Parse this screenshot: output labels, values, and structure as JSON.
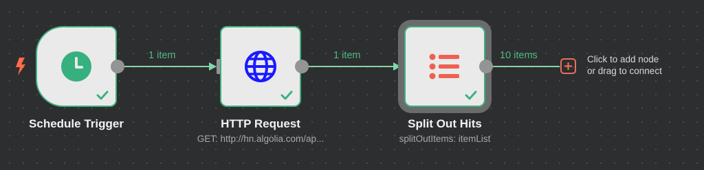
{
  "nodes": {
    "schedule_trigger": {
      "title": "Schedule Trigger",
      "subtitle": ""
    },
    "http_request": {
      "title": "HTTP Request",
      "subtitle": "GET: http://hn.algolia.com/ap..."
    },
    "split_out_hits": {
      "title": "Split Out Hits",
      "subtitle": "splitOutItems: itemList"
    }
  },
  "edges": [
    {
      "label": "1 item"
    },
    {
      "label": "1 item"
    },
    {
      "label": "10 items"
    }
  ],
  "add_node": {
    "hint_line1": "Click to add node",
    "hint_line2": "or drag to connect"
  },
  "colors": {
    "success": "#3fb07c",
    "edge": "#7fd8a8",
    "edge_label": "#4fb985",
    "trigger_icon": "#36b07f",
    "http_icon": "#1a1aff",
    "split_icon": "#ef6050",
    "add_button": "#e8705d",
    "bolt": "#ff6b4a"
  },
  "icons": {
    "trigger": "clock-icon",
    "http": "globe-icon",
    "split": "list-icon",
    "bolt": "lightning-bolt-icon",
    "status": "checkmark-icon",
    "add": "plus-icon"
  }
}
